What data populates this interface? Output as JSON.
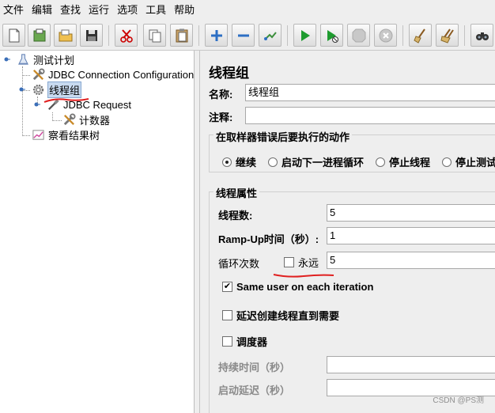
{
  "menu": [
    "文件",
    "编辑",
    "查找",
    "运行",
    "选项",
    "工具",
    "帮助"
  ],
  "toolbar": {
    "buttons": [
      "new",
      "templates",
      "open",
      "save",
      "cut",
      "copy",
      "paste",
      "expand",
      "collapse",
      "toggle",
      "start",
      "start-no-pauses",
      "stop",
      "shutdown",
      "clear",
      "clear-all",
      "search"
    ]
  },
  "tree": {
    "nodes": [
      {
        "label": "测试计划",
        "icon": "test-plan-icon"
      },
      {
        "label": "JDBC Connection Configuration",
        "icon": "wrench-icon"
      },
      {
        "label": "线程组",
        "icon": "gear-icon",
        "selected": true
      },
      {
        "label": "JDBC Request",
        "icon": "pipette-icon"
      },
      {
        "label": "计数器",
        "icon": "wrench-icon"
      },
      {
        "label": "察看结果树",
        "icon": "chart-icon"
      }
    ]
  },
  "panel": {
    "title": "线程组",
    "name_label": "名称:",
    "name_value": "线程组",
    "comment_label": "注释:",
    "comment_value": "",
    "error_group_title": "在取样器错误后要执行的动作",
    "error_options": [
      "继续",
      "启动下一进程循环",
      "停止线程",
      "停止测试"
    ],
    "error_selected": "继续",
    "props_title": "线程属性",
    "threads_label": "线程数:",
    "threads_value": "5",
    "rampup_label": "Ramp-Up时间（秒）:",
    "rampup_value": "1",
    "loop_label": "循环次数",
    "forever_label": "永远",
    "forever_checked": false,
    "loop_value": "5",
    "same_user_label": "Same user on each iteration",
    "same_user_checked": true,
    "delay_label": "延迟创建线程直到需要",
    "delay_checked": false,
    "scheduler_label": "调度器",
    "scheduler_checked": false,
    "duration_label": "持续时间（秒）",
    "duration_value": "",
    "startup_delay_label": "启动延迟（秒）",
    "startup_delay_value": ""
  },
  "watermark": "CSDN @PS测",
  "colors": {
    "annotation_red": "#e02020",
    "selection": "#c8daf0"
  }
}
